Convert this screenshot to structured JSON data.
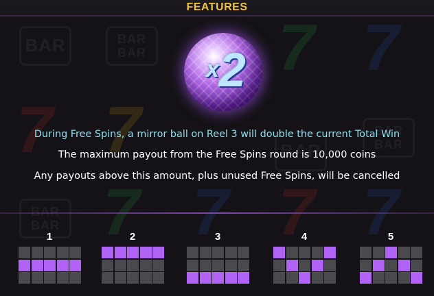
{
  "header": {
    "title": "FEATURES"
  },
  "feature": {
    "multiplier_x": "x",
    "multiplier_value": "2",
    "line1": "During Free Spins, a mirror ball on Reel 3 will double the current Total Win",
    "line2": "The maximum payout from the Free Spins round is 10,000 coins",
    "line3": "Any payouts above this amount, plus unused Free Spins, will be cancelled"
  },
  "colors": {
    "title": "#f0c23a",
    "highlight_text": "#8fe0ee",
    "active_cell": "#b163f5",
    "inactive_cell": "#4a4a4e"
  },
  "paylines": [
    {
      "number": "1",
      "rows": [
        1,
        1,
        1,
        1,
        1
      ]
    },
    {
      "number": "2",
      "rows": [
        0,
        0,
        0,
        0,
        0
      ]
    },
    {
      "number": "3",
      "rows": [
        2,
        2,
        2,
        2,
        2
      ]
    },
    {
      "number": "4",
      "rows": [
        0,
        1,
        2,
        1,
        0
      ]
    },
    {
      "number": "5",
      "rows": [
        2,
        1,
        0,
        1,
        2
      ]
    }
  ],
  "background_symbols": {
    "bar": "BAR",
    "seven": "7"
  }
}
